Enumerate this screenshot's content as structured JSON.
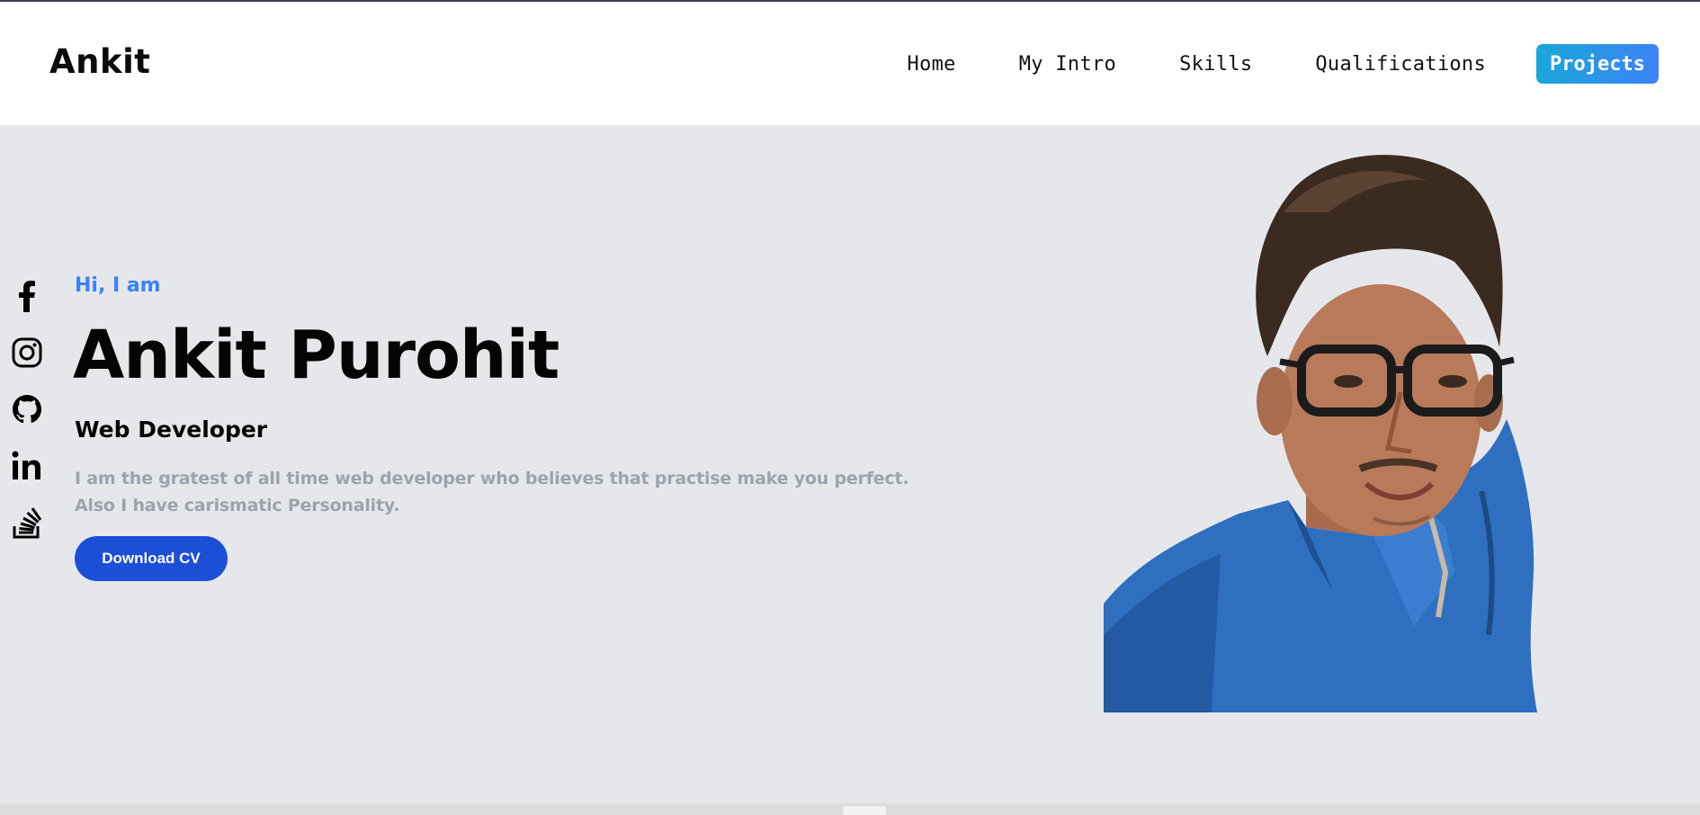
{
  "header": {
    "brand": "Ankit",
    "nav": [
      {
        "label": "Home"
      },
      {
        "label": "My Intro"
      },
      {
        "label": "Skills"
      },
      {
        "label": "Qualifications"
      }
    ],
    "cta_label": "Projects"
  },
  "social": [
    {
      "icon": "facebook-icon"
    },
    {
      "icon": "instagram-icon"
    },
    {
      "icon": "github-icon"
    },
    {
      "icon": "linkedin-icon"
    },
    {
      "icon": "stackoverflow-icon"
    }
  ],
  "hero": {
    "greeting": "Hi, I am",
    "name": "Ankit Purohit",
    "role": "Web Developer",
    "description_line1": "I am the gratest of all time web developer who believes that practise make you perfect.",
    "description_line2": "Also I have carismatic Personality.",
    "download_label": "Download CV"
  },
  "colors": {
    "accent_blue": "#3b82f6",
    "button_blue": "#1d4ed8",
    "cta_gradient_start": "#1aa7d9",
    "hero_bg": "#e5e7eb",
    "muted_text": "#9ca3af"
  }
}
